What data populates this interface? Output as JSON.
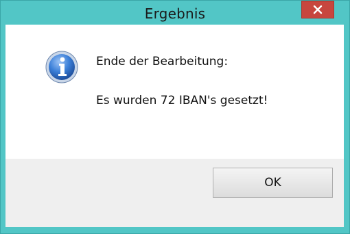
{
  "window": {
    "title": "Ergebnis",
    "close_icon": "close-icon"
  },
  "message": {
    "icon": "info-icon",
    "line1": "Ende der Bearbeitung:",
    "line2": "Es wurden 72 IBAN's gesetzt!"
  },
  "buttons": {
    "ok_label": "OK"
  },
  "colors": {
    "frame": "#52c6c6",
    "close_button": "#c7463e",
    "content_bg": "#ffffff",
    "footer_bg": "#efefef"
  }
}
